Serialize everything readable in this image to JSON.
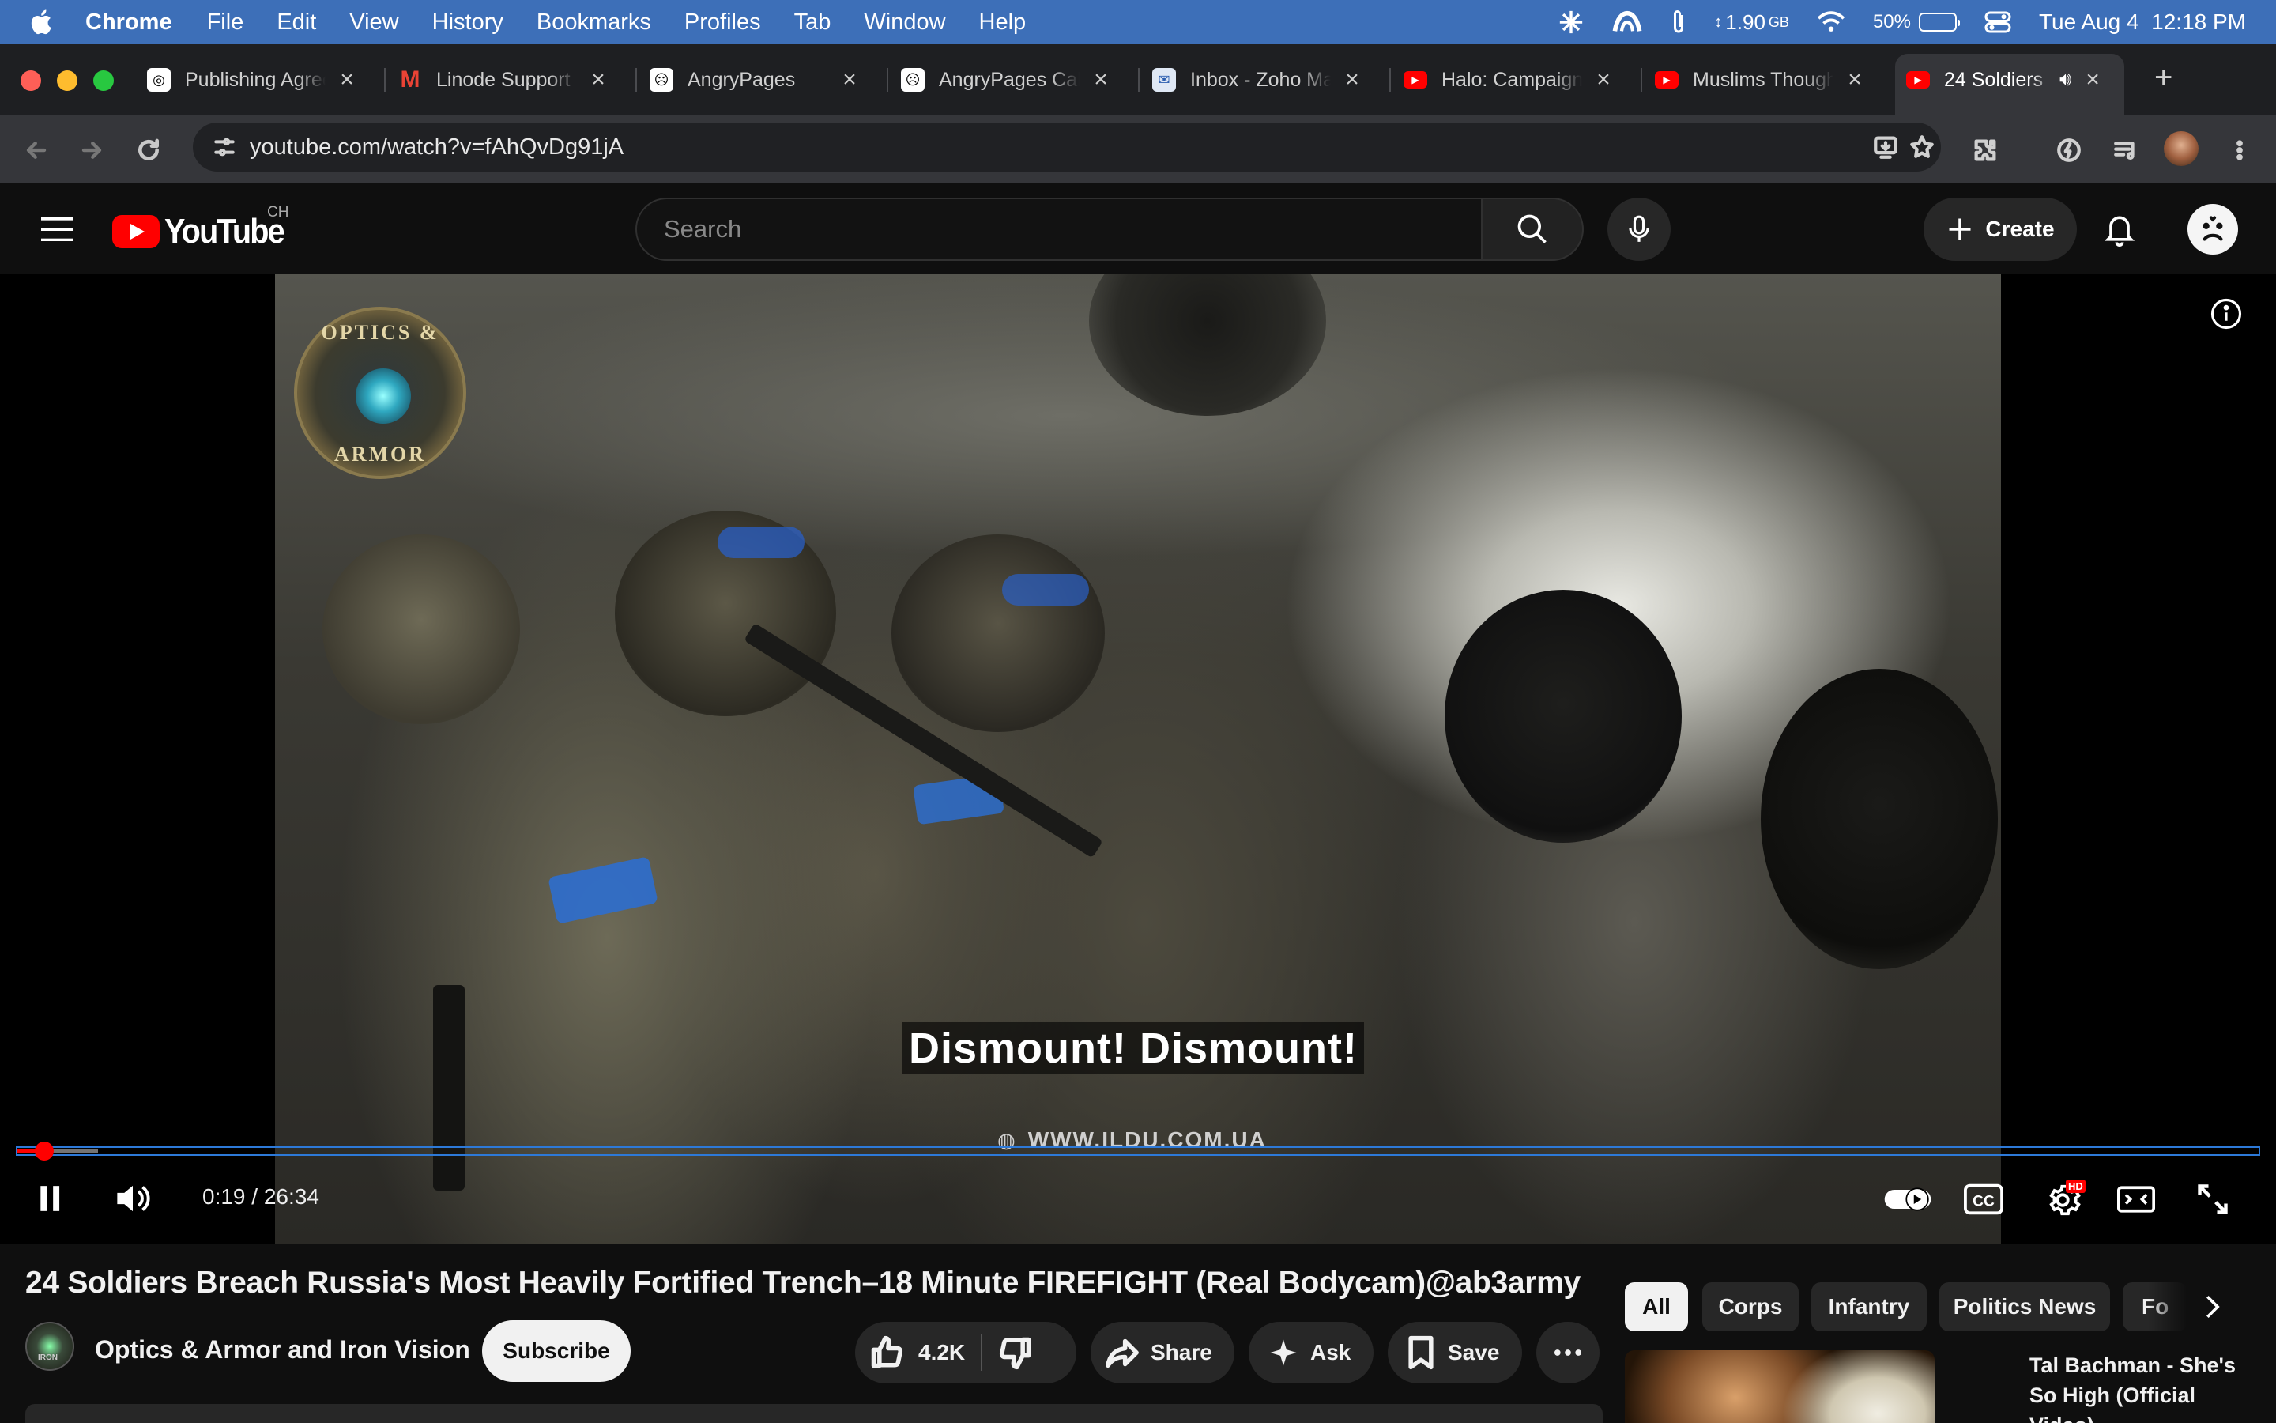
{
  "menubar": {
    "app": "Chrome",
    "items": [
      "File",
      "Edit",
      "View",
      "History",
      "Bookmarks",
      "Profiles",
      "Tab",
      "Window",
      "Help"
    ],
    "memory": "1.90",
    "memory_unit": "GB",
    "battery": "50%",
    "battery_level": 0.5,
    "datetime": "Tue Aug 4  12:18 PM"
  },
  "tabs": [
    {
      "title": "Publishing Agreement",
      "icon": "openai-icon"
    },
    {
      "title": "Linode Support",
      "icon": "gmail-icon"
    },
    {
      "title": "AngryPages",
      "icon": "angrypages-icon"
    },
    {
      "title": "AngryPages Calendar",
      "icon": "angrypages-icon"
    },
    {
      "title": "Inbox - Zoho Mail",
      "icon": "zoho-icon"
    },
    {
      "title": "Halo: Campaign",
      "icon": "youtube-icon"
    },
    {
      "title": "Muslims Thought",
      "icon": "youtube-icon"
    },
    {
      "title": "24 Soldiers",
      "icon": "youtube-icon",
      "active": true
    }
  ],
  "toolbar": {
    "url": "youtube.com/watch?v=fAhQvDg91jA"
  },
  "youtube": {
    "logo_text": "YouTube",
    "country_code": "CH",
    "search_placeholder": "Search",
    "create_label": "Create"
  },
  "player": {
    "subtitle": "Dismount! Dismount!",
    "watermark": "WWW.ILDU.COM.UA",
    "badge_top": "OPTICS &",
    "badge_bottom": "ARMOR",
    "time_current": "0:19",
    "time_separator": "/",
    "time_total": "26:34",
    "progress_played": 0.012,
    "progress_loaded": 0.036,
    "settings_badge": "HD"
  },
  "video": {
    "title": "24 Soldiers Breach Russia's Most Heavily Fortified Trench–18 Minute FIREFIGHT (Real Bodycam)@ab3army",
    "channel": "Optics & Armor and Iron Vision",
    "channel_avatar_text": "IRON",
    "subscribe_label": "Subscribe",
    "likes": "4.2K",
    "share_label": "Share",
    "ask_label": "Ask",
    "save_label": "Save"
  },
  "chips": [
    "All",
    "Corps",
    "Infantry",
    "Politics News",
    "Fo"
  ],
  "recommendation": {
    "title": "Tal Bachman - She's So High (Official Video)"
  },
  "colors": {
    "menubar": "#3d6fb8",
    "youtube_red": "#ff0000",
    "progress_outline": "#2d79d8"
  }
}
